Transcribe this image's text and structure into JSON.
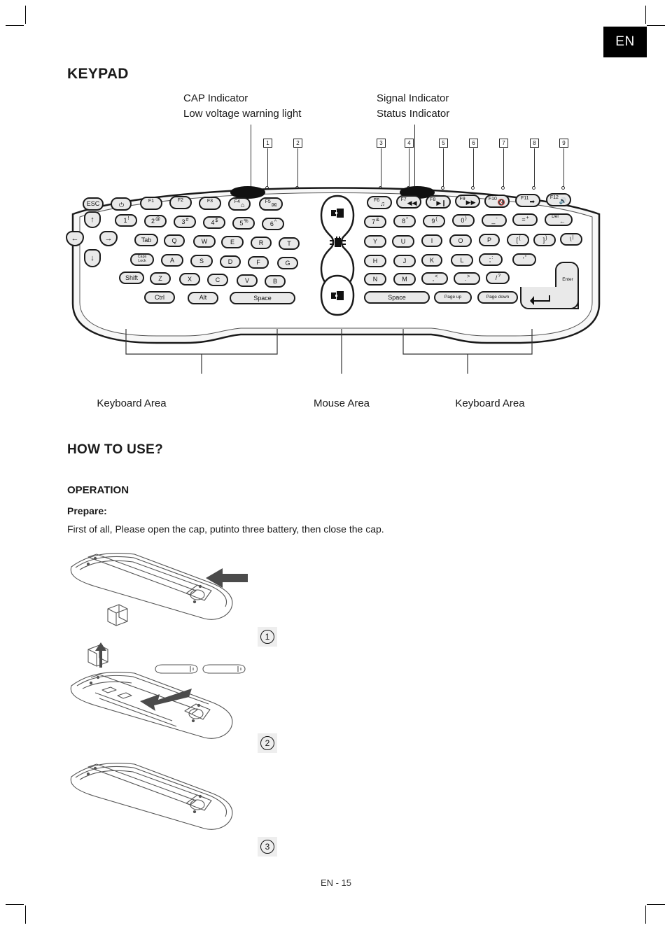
{
  "page": {
    "language_badge": "EN",
    "footer": "EN - 15"
  },
  "sections": {
    "keypad_title": "KEYPAD",
    "howto_title": "HOW TO USE?",
    "operation_title": "OPERATION",
    "prepare_title": "Prepare:",
    "prepare_text": "First of all, Please open the cap, putinto three battery, then close the cap."
  },
  "indicators": {
    "left": [
      "CAP Indicator",
      "Low voltage warning light"
    ],
    "right": [
      "Signal Indicator",
      "Status Indicator"
    ]
  },
  "callouts": [
    "1",
    "2",
    "3",
    "4",
    "5",
    "6",
    "7",
    "8",
    "9"
  ],
  "area_labels": [
    "Keyboard Area",
    "Mouse Area",
    "Keyboard Area"
  ],
  "keyboard": {
    "row_fn_left": [
      {
        "label": "ESC"
      },
      {
        "label": "",
        "icon": "power-icon"
      },
      {
        "label": "F1"
      },
      {
        "label": "F2"
      },
      {
        "label": "F3"
      },
      {
        "label": "F4",
        "icon": "home-icon"
      },
      {
        "label": "F5",
        "icon": "mail-icon"
      }
    ],
    "row_fn_right": [
      {
        "label": "F6",
        "icon": "music-note-icon"
      },
      {
        "label": "F7",
        "icon": "rewind-icon"
      },
      {
        "label": "F8",
        "icon": "play-pause-icon"
      },
      {
        "label": "F9",
        "icon": "fast-forward-icon"
      },
      {
        "label": "F10",
        "icon": "mute-icon"
      },
      {
        "label": "F11",
        "icon": "volume-down-icon"
      },
      {
        "label": "F12",
        "icon": "volume-up-icon"
      }
    ],
    "row_num_left": [
      {
        "label": "1",
        "sup": "!"
      },
      {
        "label": "2",
        "sup": "@"
      },
      {
        "label": "3",
        "sup": "#"
      },
      {
        "label": "4",
        "sup": "$"
      },
      {
        "label": "5",
        "sup": "%"
      },
      {
        "label": "6",
        "sup": "^"
      }
    ],
    "row_num_right": [
      {
        "label": "7",
        "sup": "&"
      },
      {
        "label": "8",
        "sup": "*"
      },
      {
        "label": "9",
        "sup": "("
      },
      {
        "label": "0",
        "sup": ")"
      },
      {
        "label": "_",
        "sup": "-"
      },
      {
        "label": "=",
        "sup": "+"
      },
      {
        "label": "Del",
        "icon": "backspace-icon"
      }
    ],
    "row_q_left": [
      {
        "label": "Tab"
      },
      {
        "label": "Q"
      },
      {
        "label": "W"
      },
      {
        "label": "E"
      },
      {
        "label": "R"
      },
      {
        "label": "T"
      }
    ],
    "row_q_right": [
      {
        "label": "Y"
      },
      {
        "label": "U"
      },
      {
        "label": "I"
      },
      {
        "label": "O"
      },
      {
        "label": "P"
      },
      {
        "label": "[",
        "sup": "{"
      },
      {
        "label": "]",
        "sup": "}"
      },
      {
        "label": "\\",
        "sup": "|"
      }
    ],
    "row_a_left": [
      {
        "label": "Caps Lock"
      },
      {
        "label": "A"
      },
      {
        "label": "S"
      },
      {
        "label": "D"
      },
      {
        "label": "F"
      },
      {
        "label": "G"
      }
    ],
    "row_a_right": [
      {
        "label": "H"
      },
      {
        "label": "J"
      },
      {
        "label": "K"
      },
      {
        "label": "L"
      },
      {
        "label": ";",
        "sup": ":"
      },
      {
        "label": "'",
        "sup": "\""
      }
    ],
    "row_z_left": [
      {
        "label": "Shift"
      },
      {
        "label": "Z"
      },
      {
        "label": "X"
      },
      {
        "label": "C"
      },
      {
        "label": "V"
      },
      {
        "label": "B"
      }
    ],
    "row_z_right": [
      {
        "label": "N"
      },
      {
        "label": "M"
      },
      {
        "label": ",",
        "sup": "<"
      },
      {
        "label": ".",
        "sup": ">"
      },
      {
        "label": "/",
        "sup": "?"
      }
    ],
    "row_bottom_left": [
      {
        "label": "Ctrl"
      },
      {
        "label": "Alt"
      },
      {
        "label": "Space"
      }
    ],
    "row_bottom_right": [
      {
        "label": "Space"
      },
      {
        "label": "Page up"
      },
      {
        "label": "Page down"
      }
    ],
    "arrows": [
      {
        "label": "up-arrow-key",
        "glyph": "↑"
      },
      {
        "label": "left-arrow-key",
        "glyph": "←"
      },
      {
        "label": "right-arrow-key",
        "glyph": "→"
      },
      {
        "label": "down-arrow-key",
        "glyph": "↓"
      }
    ],
    "enter_label": "Enter",
    "mouse_area": [
      {
        "name": "mouse-left-click-key"
      },
      {
        "name": "mouse-trackpad-key"
      },
      {
        "name": "mouse-right-click-key"
      }
    ]
  },
  "battery_steps": [
    "1",
    "2",
    "3"
  ],
  "colors": {
    "badge_bg": "#000000",
    "badge_text": "#ffffff",
    "key_fill": "#e9e9e9",
    "outline": "#1a1a1a",
    "step_bg": "#eeeeee"
  }
}
